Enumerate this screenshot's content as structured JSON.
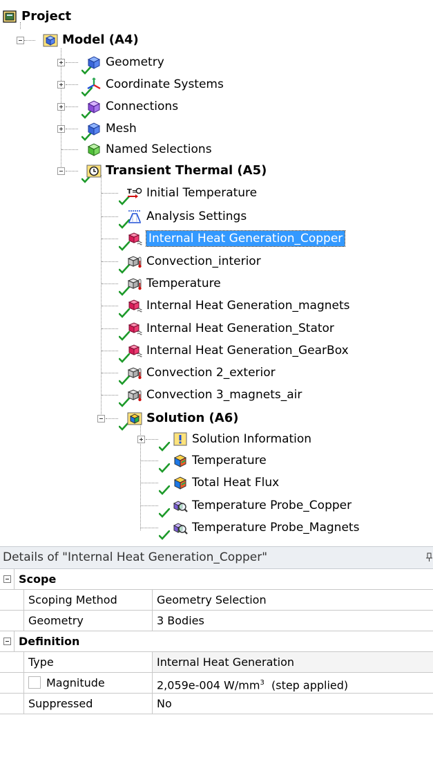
{
  "tree": {
    "project": "Project",
    "model": "Model (A4)",
    "geometry": "Geometry",
    "coordinate_systems": "Coordinate Systems",
    "connections": "Connections",
    "mesh": "Mesh",
    "named_selections": "Named Selections",
    "transient_thermal": "Transient Thermal (A5)",
    "initial_temperature": "Initial Temperature",
    "analysis_settings": "Analysis Settings",
    "ihg_copper": "Internal Heat Generation_Copper",
    "convection_interior": "Convection_interior",
    "temperature_bc": "Temperature",
    "ihg_magnets": "Internal Heat Generation_magnets",
    "ihg_stator": "Internal Heat Generation_Stator",
    "ihg_gearbox": "Internal Heat Generation_GearBox",
    "convection_2_exterior": "Convection 2_exterior",
    "convection_3_magnets_air": "Convection 3_magnets_air",
    "solution": "Solution (A6)",
    "solution_information": "Solution Information",
    "temperature_result": "Temperature",
    "total_heat_flux": "Total Heat Flux",
    "probe_copper": "Temperature Probe_Copper",
    "probe_magnets": "Temperature Probe_Magnets"
  },
  "details": {
    "title": "Details of \"Internal Heat Generation_Copper\"",
    "scope_header": "Scope",
    "scoping_method_label": "Scoping Method",
    "scoping_method_value": "Geometry Selection",
    "geometry_label": "Geometry",
    "geometry_value": "3 Bodies",
    "definition_header": "Definition",
    "type_label": "Type",
    "type_value": "Internal Heat Generation",
    "magnitude_label": "Magnitude",
    "magnitude_value": "2,059e-004 W/mm",
    "magnitude_unit_sup": "3",
    "magnitude_suffix": "(step applied)",
    "suppressed_label": "Suppressed",
    "suppressed_value": "No"
  },
  "colors": {
    "selection": "#3399ff",
    "check_green": "#2a9a2a",
    "header_bg": "#eceff3",
    "readonly_bg": "#f4f4f4"
  }
}
